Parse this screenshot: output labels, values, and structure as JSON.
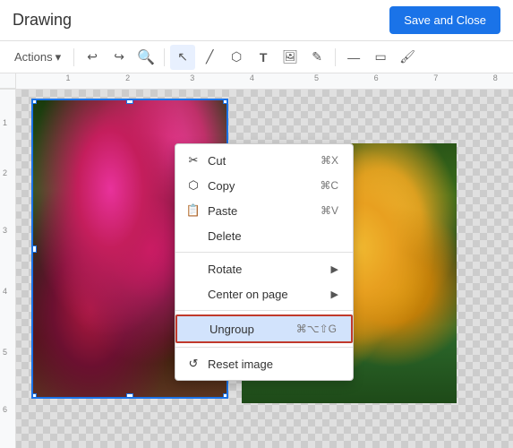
{
  "header": {
    "title": "Drawing",
    "save_close_label": "Save and Close"
  },
  "toolbar": {
    "actions_label": "Actions",
    "undo_icon": "↩",
    "redo_icon": "↪",
    "zoom_icon": "⌕",
    "select_icon": "↖",
    "line_icon": "╱",
    "shape_icon": "⬡",
    "text_icon": "T",
    "image_icon": "⬜",
    "pen_icon": "✎",
    "line_style_icon": "—",
    "border_icon": "▭",
    "fill_icon": "🖌"
  },
  "context_menu": {
    "cut_label": "Cut",
    "cut_shortcut": "⌘X",
    "copy_label": "Copy",
    "copy_shortcut": "⌘C",
    "paste_label": "Paste",
    "paste_shortcut": "⌘V",
    "delete_label": "Delete",
    "rotate_label": "Rotate",
    "center_on_page_label": "Center on page",
    "ungroup_label": "Ungroup",
    "ungroup_shortcut": "⌘⌥⇧G",
    "reset_image_label": "Reset image"
  },
  "ruler": {
    "numbers": [
      "1",
      "2",
      "3",
      "4",
      "5",
      "6",
      "7",
      "8"
    ]
  },
  "colors": {
    "accent": "#1a73e8",
    "save_btn_bg": "#1a73e8",
    "highlight_border": "#c0392b",
    "highlight_bg": "#d2e3fc"
  }
}
